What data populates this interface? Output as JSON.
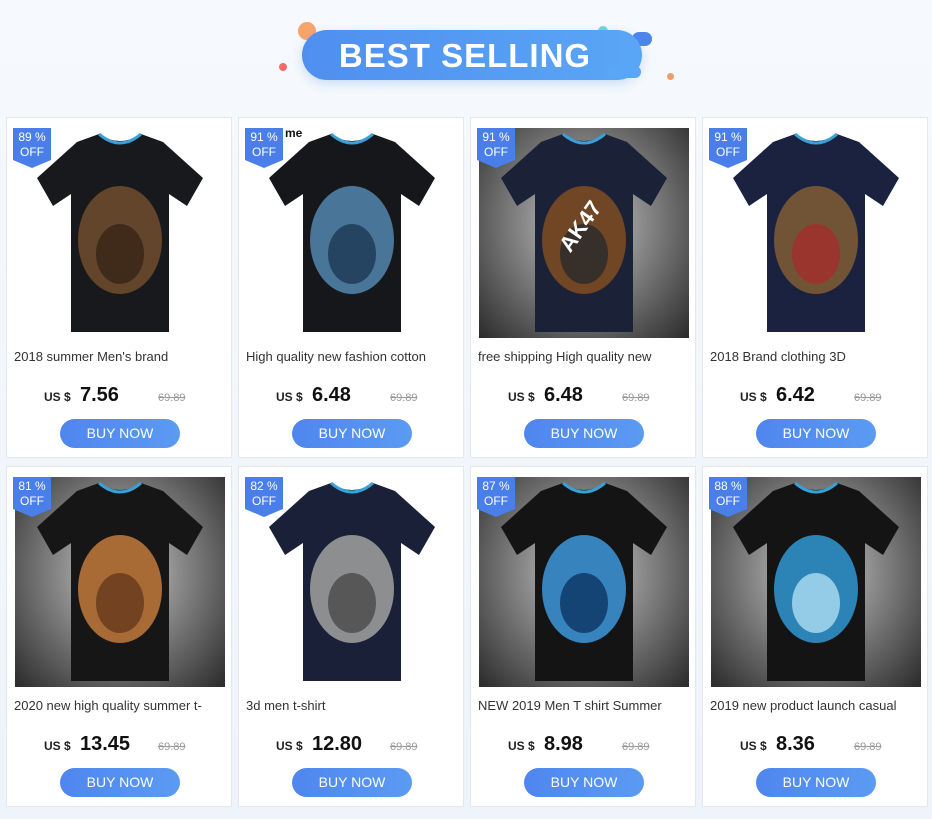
{
  "banner": {
    "title": "BEST SELLING"
  },
  "currency_label": "US $",
  "buy_label": "BUY NOW",
  "colors": {
    "accent": "#4f86ef",
    "badge": "#4a7ee8"
  },
  "products": [
    {
      "discount_pct": "89 %",
      "discount_label": "OFF",
      "title": "2018 summer Men's brand",
      "price": "7.56",
      "old_price": "69.89",
      "print_icon": "monkey-face-print",
      "photo": "white",
      "shirt": "#17191c"
    },
    {
      "discount_pct": "91 %",
      "discount_label": "OFF",
      "title": "High quality new fashion cotton",
      "price": "6.48",
      "old_price": "69.89",
      "print_icon": "wolf-moon-print",
      "photo": "white",
      "shirt": "#15171a",
      "overlay_text": "r me"
    },
    {
      "discount_pct": "91 %",
      "discount_label": "OFF",
      "title": "free shipping High quality new",
      "price": "6.48",
      "old_price": "69.89",
      "print_icon": "rifle-print",
      "photo": "dark",
      "shirt": "#1b2238",
      "print_text": "AK47"
    },
    {
      "discount_pct": "91 %",
      "discount_label": "OFF",
      "title": "2018 Brand clothing 3D",
      "price": "6.42",
      "old_price": "69.89",
      "print_icon": "gorilla-cap-print",
      "photo": "white",
      "shirt": "#1a2240"
    },
    {
      "discount_pct": "81 %",
      "discount_label": "OFF",
      "title": "2020 new high quality summer t-",
      "price": "13.45",
      "old_price": "69.89",
      "print_icon": "feather-headdress-print",
      "photo": "dark",
      "shirt": "#161616"
    },
    {
      "discount_pct": "82 %",
      "discount_label": "OFF",
      "title": "3d men t-shirt",
      "price": "12.80",
      "old_price": "69.89",
      "print_icon": "wolf-face-print",
      "photo": "white",
      "shirt": "#1a2038"
    },
    {
      "discount_pct": "87 %",
      "discount_label": "OFF",
      "title": "NEW 2019  Men T shirt Summer",
      "price": "8.98",
      "old_price": "69.89",
      "print_icon": "owl-print",
      "photo": "dark",
      "shirt": "#141414"
    },
    {
      "discount_pct": "88 %",
      "discount_label": "OFF",
      "title": "2019 new product launch casual",
      "price": "8.36",
      "old_price": "69.89",
      "print_icon": "orca-wave-print",
      "photo": "dark",
      "shirt": "#141414"
    }
  ]
}
